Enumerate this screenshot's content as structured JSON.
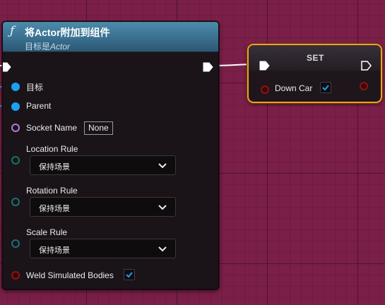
{
  "function_node": {
    "icon": "function-icon",
    "title": "将Actor附加到组件",
    "subtitle_prefix": "目标是",
    "subtitle_class": "Actor",
    "pins": {
      "target_label": "目标",
      "parent_label": "Parent",
      "socket_name_label": "Socket Name",
      "socket_name_value": "None",
      "location_rule_label": "Location Rule",
      "location_rule_value": "保持场景",
      "rotation_rule_label": "Rotation Rule",
      "rotation_rule_value": "保持场景",
      "scale_rule_label": "Scale Rule",
      "scale_rule_value": "保持场景",
      "weld_label": "Weld Simulated Bodies",
      "weld_checked": true
    },
    "header_color": "#3a7090"
  },
  "set_node": {
    "title": "SET",
    "variable_label": "Down Car",
    "variable_checked": true,
    "selected_outline_color": "#f0a020"
  },
  "colors": {
    "object_pin": "#1aa1f2",
    "name_pin": "#b37bd9",
    "enum_pin": "#1a7070",
    "bool_pin": "#8c1414",
    "graph_background": "#7a1f48"
  }
}
